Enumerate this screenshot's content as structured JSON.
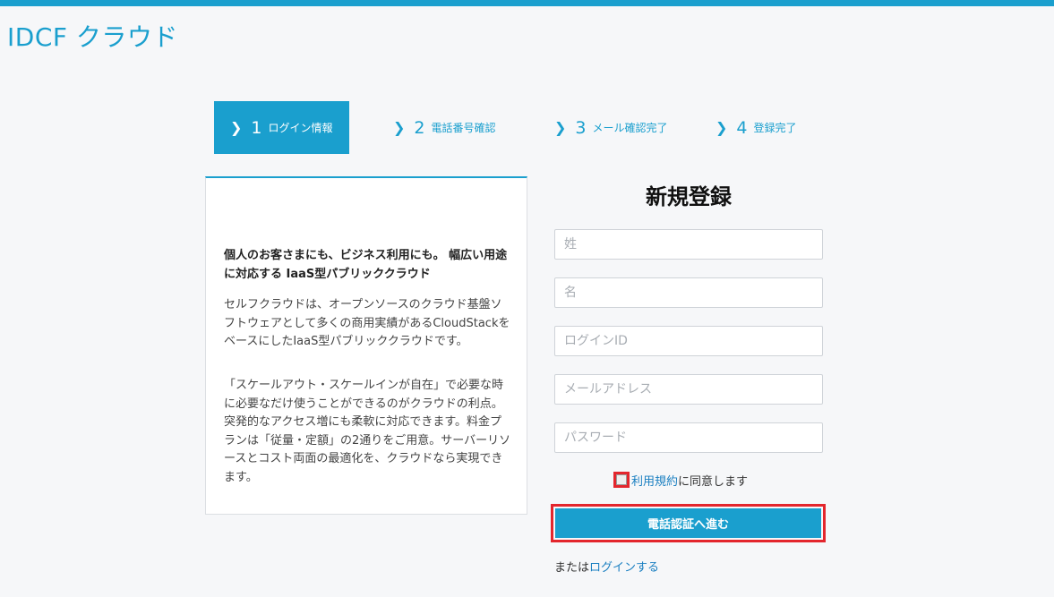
{
  "header": {
    "logo": "IDCF クラウド"
  },
  "steps": [
    {
      "num": "1",
      "label": "ログイン情報",
      "active": true
    },
    {
      "num": "2",
      "label": "電話番号確認",
      "active": false
    },
    {
      "num": "3",
      "label": "メール確認完了",
      "active": false
    },
    {
      "num": "4",
      "label": "登録完了",
      "active": false
    }
  ],
  "info": {
    "heading": "個人のお客さまにも、ビジネス利用にも。 幅広い用途に対応する IaaS型パブリッククラウド",
    "paragraph1": "セルフクラウドは、オープンソースのクラウド基盤ソフトウェアとして多くの商用実績があるCloudStackをベースにしたIaaS型パブリッククラウドです。",
    "paragraph2": "「スケールアウト・スケールインが自在」で必要な時に必要なだけ使うことができるのがクラウドの利点。突発的なアクセス増にも柔軟に対応できます。料金プランは「従量・定額」の2通りをご用意。サーバーリソースとコスト両面の最適化を、クラウドなら実現できます。"
  },
  "form": {
    "title": "新規登録",
    "last_name_placeholder": "姓",
    "first_name_placeholder": "名",
    "login_id_placeholder": "ログインID",
    "email_placeholder": "メールアドレス",
    "password_placeholder": "パスワード",
    "terms_link": "利用規約",
    "terms_suffix": "に同意します",
    "submit_label": "電話認証へ進む",
    "or_prefix": "または",
    "login_link": "ログインする"
  },
  "colors": {
    "accent": "#1a9fce",
    "highlight": "#e3262d"
  }
}
